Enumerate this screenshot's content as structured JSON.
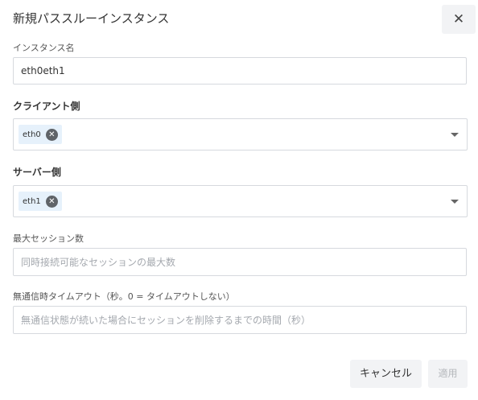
{
  "dialog": {
    "title": "新規パススルーインスタンス",
    "close_symbol": "✕"
  },
  "instance_name": {
    "label": "インスタンス名",
    "value": "eth0eth1"
  },
  "client_side": {
    "label": "クライアント側",
    "chips": [
      "eth0"
    ]
  },
  "server_side": {
    "label": "サーバー側",
    "chips": [
      "eth1"
    ]
  },
  "max_sessions": {
    "label": "最大セッション数",
    "placeholder": "同時接続可能なセッションの最大数",
    "value": ""
  },
  "timeout": {
    "label": "無通信時タイムアウト（秒。0 = タイムアウトしない）",
    "placeholder": "無通信状態が続いた場合にセッションを削除するまでの時間（秒）",
    "value": ""
  },
  "footer": {
    "cancel_label": "キャンセル",
    "apply_label": "適用"
  },
  "chip_remove_symbol": "✕",
  "colors": {
    "chip_background": "#e6f1fb",
    "button_background": "#f2f3f5",
    "border": "#d6d9de",
    "apply_disabled_text": "#b5b8bc"
  }
}
